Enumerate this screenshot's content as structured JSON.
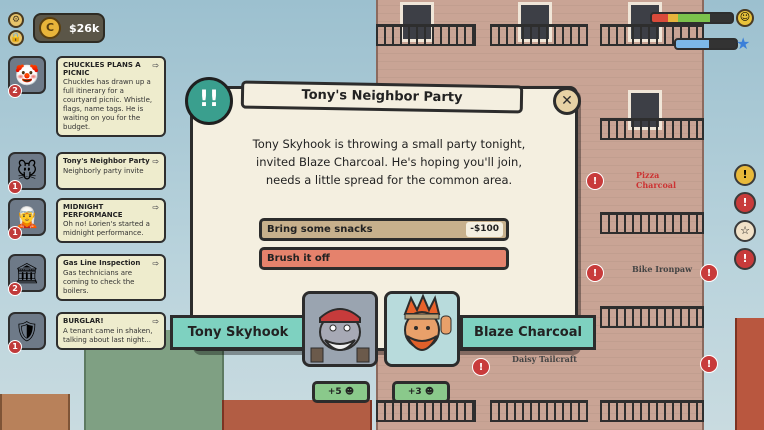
{
  "hud": {
    "money": "$26k",
    "coin_symbol": "C",
    "happiness": 0.72,
    "level_progress": 0.55
  },
  "notifications": [
    {
      "title": "CHUCKLES PLANS A PICNIC",
      "body": "Chuckles has drawn up a full itinerary for a courtyard picnic. Whistle, flags, name tags. He is waiting on you for the budget.",
      "badge": "2",
      "icon": "clown-portrait-icon"
    },
    {
      "title": "Tony's Neighbor Party",
      "body": "Neighborly party invite",
      "badge": "1",
      "icon": "tony-portrait-icon"
    },
    {
      "title": "MIDNIGHT PERFORMANCE",
      "body": "Oh no! Lorien's started a midnight performance.",
      "badge": "1",
      "icon": "lorien-portrait-icon"
    },
    {
      "title": "Gas Line Inspection",
      "body": "Gas technicians are coming to check the boilers.",
      "badge": "2",
      "icon": "bank-icon"
    },
    {
      "title": "BURGLAR!",
      "body": "A tenant came in shaken, talking about last night...",
      "badge": "1",
      "icon": "police-badge-icon"
    }
  ],
  "dialog": {
    "alert": "!!",
    "title": "Tony's Neighbor Party",
    "description": "Tony Skyhook is throwing a small party tonight, invited Blaze Charcoal. He's hoping you'll join, needs a little spread for the common area.",
    "choices": [
      {
        "label": "Bring some snacks",
        "cost": "-$100"
      },
      {
        "label": "Brush it off"
      }
    ],
    "characters": [
      {
        "name": "Tony Skyhook",
        "rep": "+5"
      },
      {
        "name": "Blaze Charcoal",
        "rep": "+3"
      }
    ]
  },
  "scene": {
    "signs": [
      "Pizza Charcoal",
      "Bike Ironpaw",
      "Daisy Tailcraft"
    ]
  },
  "colors": {
    "accent": "#7ed1c0",
    "dialog_bg": "#f4efe0",
    "alert": "#3a9f8e",
    "danger": "#c83b3b"
  }
}
